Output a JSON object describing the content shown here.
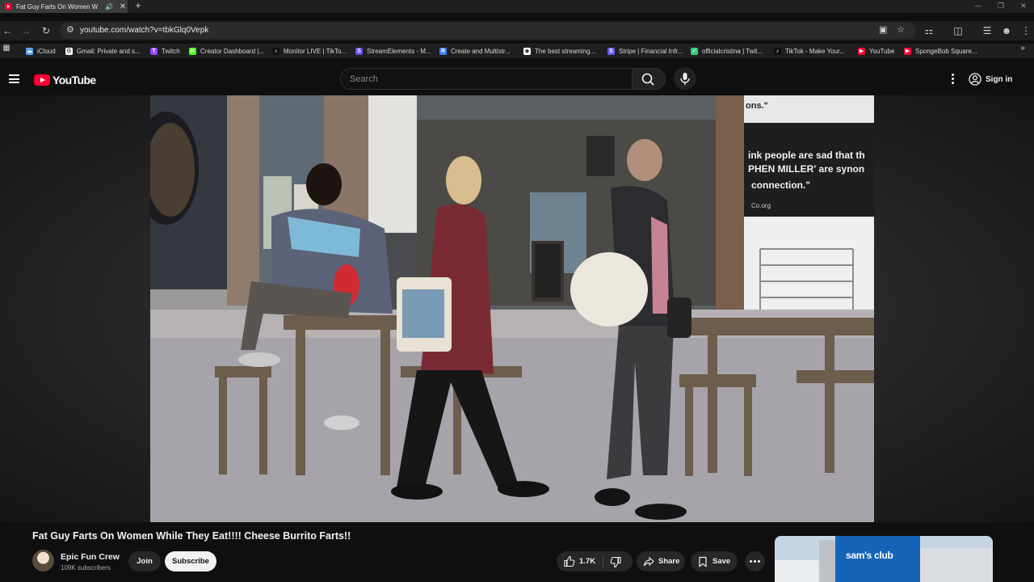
{
  "browser": {
    "tab_title": "Fat Guy Farts On Women W",
    "new_tab": "+",
    "url": "youtube.com/watch?v=tbkGlq0Vepk",
    "bookmarks": [
      {
        "label": "iCloud",
        "icon": "cloud-icon",
        "color": "#5aa7f0"
      },
      {
        "label": "Gmail: Private and s...",
        "icon": "google-icon",
        "color": "#ffffff"
      },
      {
        "label": "Twitch",
        "icon": "twitch-icon",
        "color": "#9146ff"
      },
      {
        "label": "Creator Dashboard |...",
        "icon": "kick-icon",
        "color": "#53fc18"
      },
      {
        "label": "Monitor LIVE | TikTo...",
        "icon": "tiktok-icon",
        "color": "#111111"
      },
      {
        "label": "StreamElements - M...",
        "icon": "streamelements-icon",
        "color": "#6a4cff"
      },
      {
        "label": "Create and Multistr...",
        "icon": "restream-icon",
        "color": "#3d7cff"
      },
      {
        "label": "The best streaming...",
        "icon": "diamond-icon",
        "color": "#ffffff"
      },
      {
        "label": "Stripe | Financial Infr...",
        "icon": "stripe-icon",
        "color": "#635bff"
      },
      {
        "label": "officialcristina | Twit...",
        "icon": "twitter-icon",
        "color": "#33d17a"
      },
      {
        "label": "TikTok - Make Your...",
        "icon": "tiktok-icon",
        "color": "#111111"
      },
      {
        "label": "YouTube",
        "icon": "youtube-icon",
        "color": "#ff0033"
      },
      {
        "label": "SpongeBob Square...",
        "icon": "youtube-icon",
        "color": "#ff0033"
      }
    ]
  },
  "youtube": {
    "logo_text": "YouTube",
    "search_placeholder": "Search",
    "signin_label": "Sign in",
    "accent": "#ff0033"
  },
  "video": {
    "title": "Fat Guy Farts On Women While They Eat!!!! Cheese Burrito Farts!!",
    "channel_name": "Epic Fun Crew",
    "subscribers": "109K subscribers",
    "join_label": "Join",
    "subscribe_label": "Subscribe",
    "like_count": "1.7K",
    "share_label": "Share",
    "save_label": "Save",
    "scene_text": {
      "sign_line1": "ons.\"",
      "sign_line2": "ink people are sad that th",
      "sign_line3": "PHEN MILLER' are synon",
      "sign_line4": "connection.\"",
      "sign_site": "Co.org"
    }
  },
  "ad": {
    "brand_text": "sam's club"
  }
}
